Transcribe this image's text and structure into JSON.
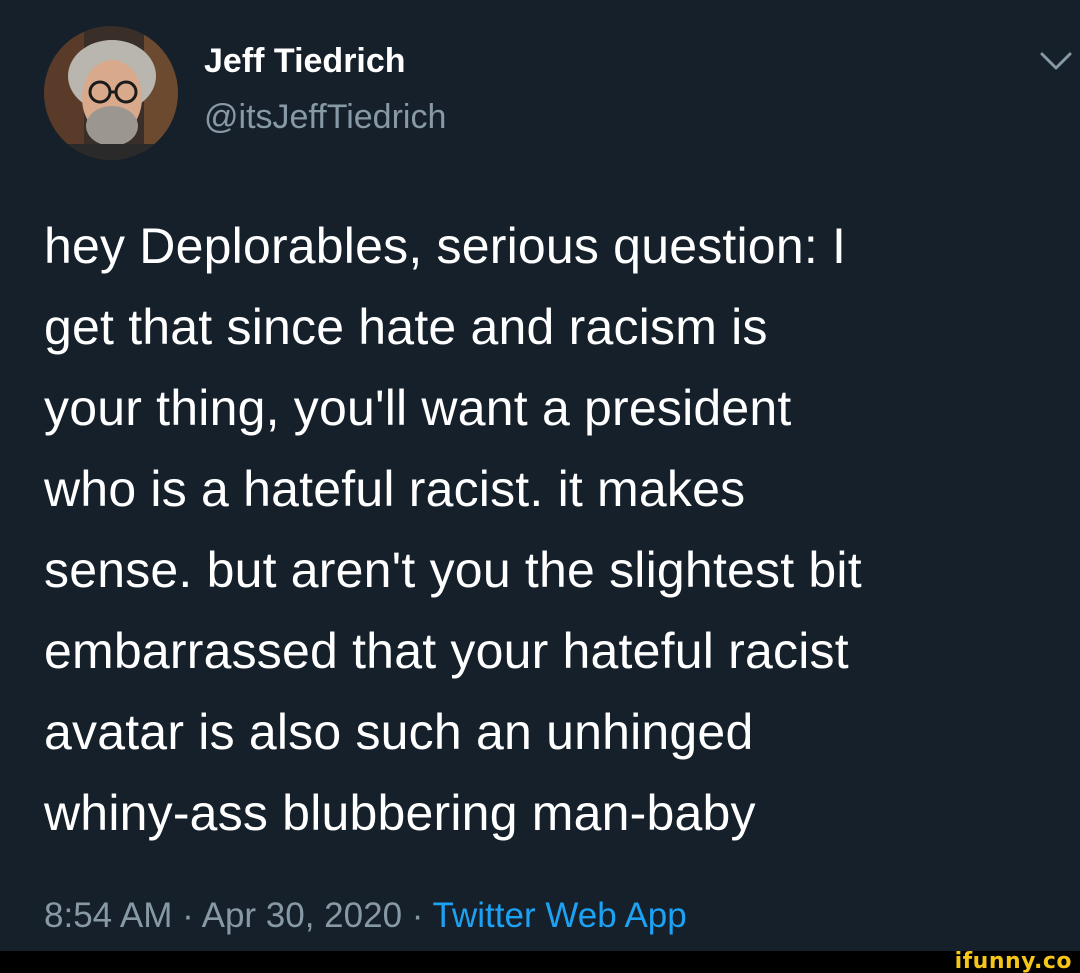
{
  "author": {
    "display_name": "Jeff Tiedrich",
    "handle": "@itsJeffTiedrich"
  },
  "icons": {
    "avatar": "profile-photo",
    "menu": "chevron-down-icon"
  },
  "tweet": {
    "text": "hey Deplorables, serious question: I\nget that since hate and racism is\nyour thing, you'll want a president\nwho is a hateful racist. it makes\nsense. but aren't you the slightest bit\nembarrassed that your hateful racist\navatar is also such an unhinged\nwhiny-ass blubbering man-baby"
  },
  "meta": {
    "time": "8:54 AM",
    "separator": "·",
    "date": "Apr 30, 2020",
    "source": "Twitter Web App"
  },
  "watermark": {
    "text": "ifunny.co"
  },
  "colors": {
    "background": "#15202b",
    "primary_text": "#ffffff",
    "secondary_text": "#8899a6",
    "link": "#1da1f2",
    "watermark": "#f5c518"
  }
}
